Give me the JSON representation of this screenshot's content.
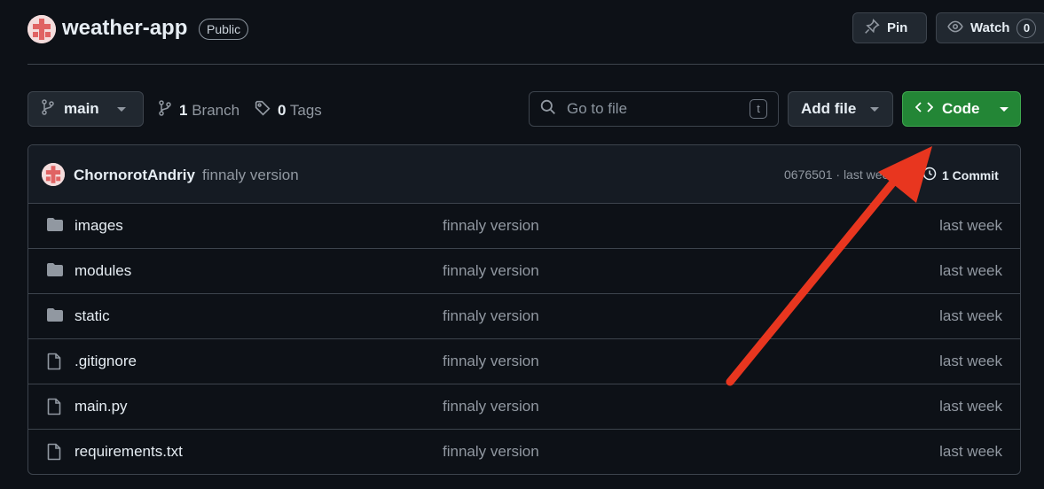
{
  "repo": {
    "name": "weather-app",
    "visibility": "Public"
  },
  "header_actions": {
    "pin_label": "Pin",
    "watch_label": "Watch",
    "watch_count": "0"
  },
  "toolbar": {
    "branch": "main",
    "branch_count": "1",
    "branch_label": "Branch",
    "tag_count": "0",
    "tag_label": "Tags",
    "goto_placeholder": "Go to file",
    "goto_shortcut": "t",
    "add_file_label": "Add file",
    "code_label": "Code"
  },
  "latest_commit": {
    "author": "ChornorotAndriy",
    "message": "finnaly version",
    "hash_text": "0676501 · last week",
    "count_label": "1 Commit"
  },
  "files": [
    {
      "name": "images",
      "type": "folder",
      "message": "finnaly version",
      "date": "last week"
    },
    {
      "name": "modules",
      "type": "folder",
      "message": "finnaly version",
      "date": "last week"
    },
    {
      "name": "static",
      "type": "folder",
      "message": "finnaly version",
      "date": "last week"
    },
    {
      "name": ".gitignore",
      "type": "file",
      "message": "finnaly version",
      "date": "last week"
    },
    {
      "name": "main.py",
      "type": "file",
      "message": "finnaly version",
      "date": "last week"
    },
    {
      "name": "requirements.txt",
      "type": "file",
      "message": "finnaly version",
      "date": "last week"
    }
  ],
  "colors": {
    "background": "#0d1117",
    "code_button": "#238636",
    "annotation_arrow": "#e8361f"
  }
}
